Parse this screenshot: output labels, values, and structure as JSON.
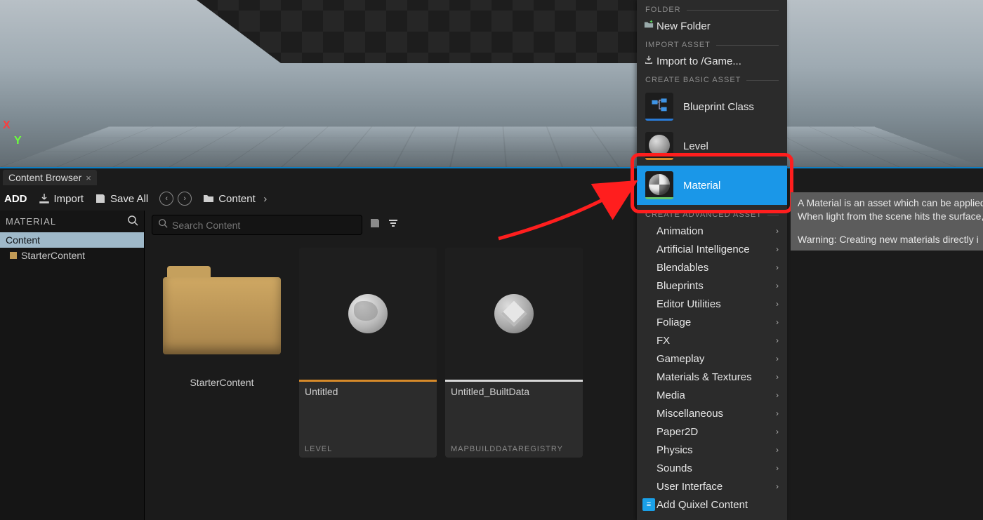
{
  "viewport": {
    "axis_x": "X",
    "axis_y": "Y",
    "axis_z": ""
  },
  "content_browser": {
    "tab_title": "Content Browser",
    "toolbar": {
      "add": "ADD",
      "import": "Import",
      "save_all": "Save All",
      "breadcrumb": "Content"
    },
    "left": {
      "header": "MATERIAL",
      "root": "Content",
      "child": "StarterContent"
    },
    "search_placeholder": "Search Content",
    "assets": {
      "folder_name": "StarterContent",
      "level": {
        "name": "Untitled",
        "type": "LEVEL"
      },
      "builddata": {
        "name": "Untitled_BuiltData",
        "type": "MAPBUILDDATAREGISTRY"
      }
    }
  },
  "ctx": {
    "sec_folder": "FOLDER",
    "new_folder": "New Folder",
    "sec_import": "IMPORT ASSET",
    "import_to": "Import to /Game...",
    "sec_basic": "CREATE BASIC ASSET",
    "blueprint": "Blueprint Class",
    "level": "Level",
    "material": "Material",
    "sec_adv": "CREATE ADVANCED ASSET",
    "adv": {
      "animation": "Animation",
      "ai": "Artificial Intelligence",
      "blendables": "Blendables",
      "blueprints": "Blueprints",
      "editor_utilities": "Editor Utilities",
      "foliage": "Foliage",
      "fx": "FX",
      "gameplay": "Gameplay",
      "mats": "Materials & Textures",
      "media": "Media",
      "misc": "Miscellaneous",
      "paper2d": "Paper2D",
      "physics": "Physics",
      "sounds": "Sounds",
      "ui": "User Interface"
    },
    "quixel": "Add Quixel Content"
  },
  "tooltip": {
    "line1": "A Material is an asset which can be applied",
    "line2": "When light from the scene hits the surface,",
    "warn": "Warning: Creating new materials directly i"
  }
}
